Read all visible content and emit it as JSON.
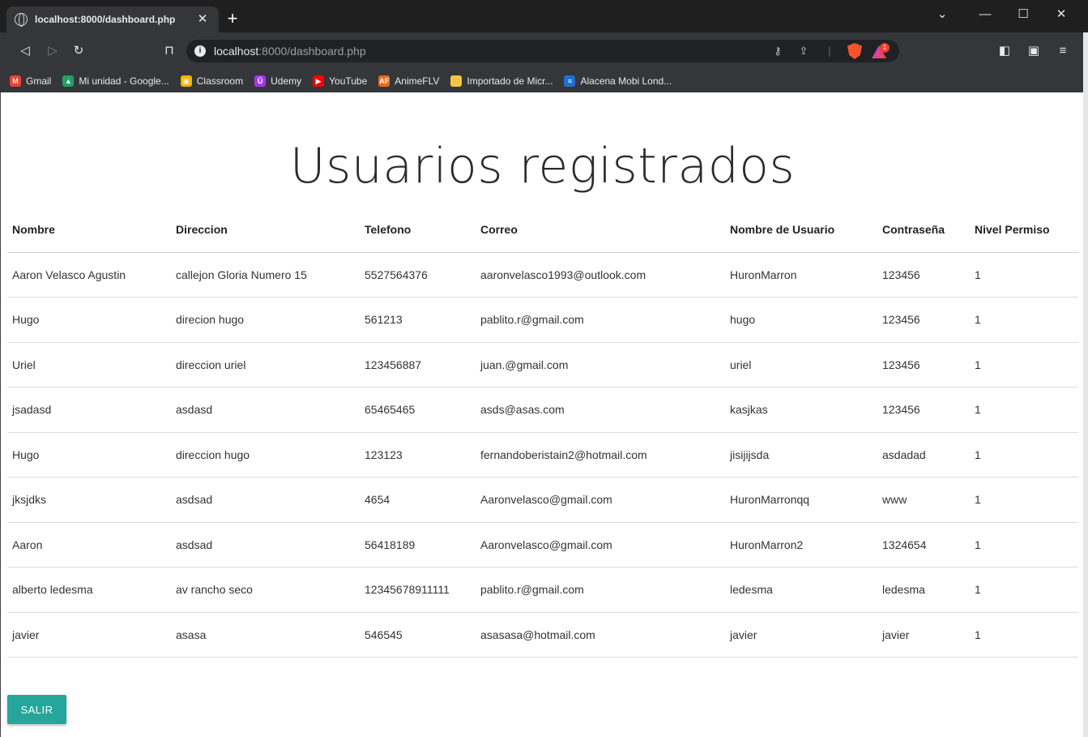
{
  "browser": {
    "tab_title": "localhost:8000/dashboard.php",
    "url_host": "localhost",
    "url_rest": ":8000/dashboard.php",
    "rewards_count": "1",
    "bookmarks": [
      {
        "label": "Gmail",
        "icon": "gmail-icon",
        "color": "#ea4335",
        "glyph": "M"
      },
      {
        "label": "Mi unidad - Google...",
        "icon": "google-drive-icon",
        "color": "#1fa463",
        "glyph": "▲"
      },
      {
        "label": "Classroom",
        "icon": "classroom-icon",
        "color": "#f6b400",
        "glyph": "▣"
      },
      {
        "label": "Udemy",
        "icon": "udemy-icon",
        "color": "#a435f0",
        "glyph": "Ū"
      },
      {
        "label": "YouTube",
        "icon": "youtube-icon",
        "color": "#ff0000",
        "glyph": "▶"
      },
      {
        "label": "AnimeFLV",
        "icon": "animeflv-icon",
        "color": "#e86c1a",
        "glyph": "AF"
      },
      {
        "label": "Importado de Micr...",
        "icon": "folder-icon",
        "color": "#f4c542",
        "glyph": ""
      },
      {
        "label": "Alacena Mobi Lond...",
        "icon": "alacena-icon",
        "color": "#1f6fd1",
        "glyph": "≡"
      }
    ]
  },
  "page": {
    "title": "Usuarios registrados",
    "columns": [
      "Nombre",
      "Direccion",
      "Telefono",
      "Correo",
      "Nombre de Usuario",
      "Contraseña",
      "Nivel Permiso"
    ],
    "rows": [
      [
        "Aaron Velasco Agustin",
        "callejon Gloria Numero 15",
        "5527564376",
        "aaronvelasco1993@outlook.com",
        "HuronMarron",
        "123456",
        "1"
      ],
      [
        "Hugo",
        "direcion hugo",
        "561213",
        "pablito.r@gmail.com",
        "hugo",
        "123456",
        "1"
      ],
      [
        "Uriel",
        "direccion uriel",
        "123456887",
        "juan.@gmail.com",
        "uriel",
        "123456",
        "1"
      ],
      [
        "jsadasd",
        "asdasd",
        "65465465",
        "asds@asas.com",
        "kasjkas",
        "123456",
        "1"
      ],
      [
        "Hugo",
        "direccion hugo",
        "123123",
        "fernandoberistain2@hotmail.com",
        "jisijijsda",
        "asdadad",
        "1"
      ],
      [
        "jksjdks",
        "asdsad",
        "4654",
        "Aaronvelasco@gmail.com",
        "HuronMarronqq",
        "www",
        "1"
      ],
      [
        "Aaron",
        "asdsad",
        "56418189",
        "Aaronvelasco@gmail.com",
        "HuronMarron2",
        "1324654",
        "1"
      ],
      [
        "alberto ledesma",
        "av rancho seco",
        "12345678911111",
        "pablito.r@gmail.com",
        "ledesma",
        "ledesma",
        "1"
      ],
      [
        "javier",
        "asasa",
        "546545",
        "asasasa@hotmail.com",
        "javier",
        "javier",
        "1"
      ]
    ],
    "logout_label": "SALIR",
    "accent_color": "#26a69a"
  }
}
